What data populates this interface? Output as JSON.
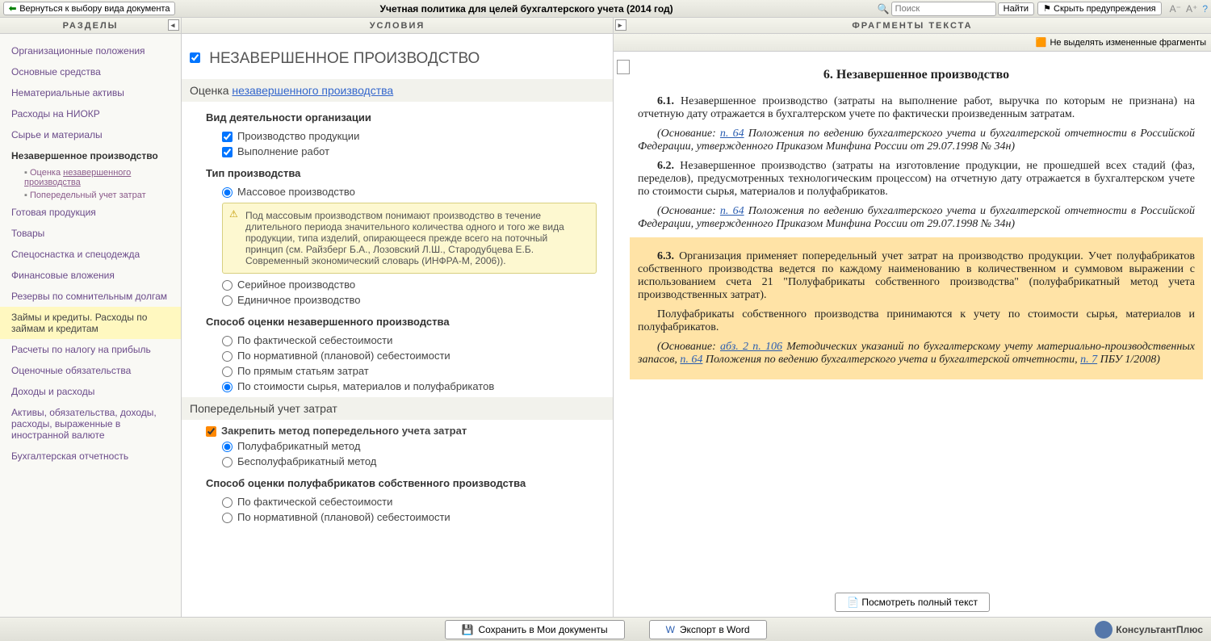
{
  "topbar": {
    "back": "Вернуться к выбору вида документа",
    "title": "Учетная политика для целей бухгалтерского учета (2014 год)",
    "search_placeholder": "Поиск",
    "find": "Найти",
    "hide_warn": "Скрыть предупреждения"
  },
  "headers": {
    "col1": "РАЗДЕЛЫ",
    "col2": "УСЛОВИЯ",
    "col3": "ФРАГМЕНТЫ ТЕКСТА"
  },
  "sidebar": {
    "items": [
      "Организационные положения",
      "Основные средства",
      "Нематериальные активы",
      "Расходы на НИОКР",
      "Сырье и материалы",
      "Незавершенное производство",
      "Готовая продукция",
      "Товары",
      "Спецоснастка и спецодежда",
      "Финансовые вложения",
      "Резервы по сомнительным долгам",
      "Займы и кредиты. Расходы по займам и кредитам",
      "Расчеты по налогу на прибыль",
      "Оценочные обязательства",
      "Доходы и расходы",
      "Активы, обязательства, доходы, расходы, выраженные в иностранной валюте",
      "Бухгалтерская отчетность"
    ],
    "sub": {
      "s1_prefix": "Оценка ",
      "s1_link": "незавершенного производства",
      "s2": "Попередельный учет затрат"
    }
  },
  "cond": {
    "main_title": "НЕЗАВЕРШЕННОЕ ПРОИЗВОДСТВО",
    "sec1_prefix": "Оценка ",
    "sec1_link": "незавершенного производства",
    "h_activity": "Вид деятельности организации",
    "c_prod": "Производство продукции",
    "c_work": "Выполнение работ",
    "h_type": "Тип производства",
    "r_mass": "Массовое производство",
    "info_mass": "Под массовым производством понимают производство в течение длительного периода значительного количества одного и того же вида продукции, типа изделий, опирающееся прежде всего на поточный принцип (см. Райзберг Б.А., Лозовский Л.Ш., Стародубцева Е.Б. Современный экономический словарь (ИНФРА-М, 2006)).",
    "r_serial": "Серийное производство",
    "r_single": "Единичное производство",
    "h_eval": "Способ оценки незавершенного производства",
    "r_fact": "По фактической себестоимости",
    "r_norm": "По нормативной (плановой) себестоимости",
    "r_direct": "По прямым статьям затрат",
    "r_cost": "По стоимости сырья, материалов и полуфабрикатов",
    "sec2": "Попередельный учет затрат",
    "c_fix": "Закрепить метод попередельного учета затрат",
    "r_semi": "Полуфабрикатный метод",
    "r_nonsemi": "Бесполуфабрикатный метод",
    "h_eval2": "Способ оценки полуфабрикатов собственного производства",
    "r_fact2": "По фактической себестоимости",
    "r_norm2": "По нормативной (плановой) себестоимости"
  },
  "frag": {
    "toolbar_btn": "Не выделять измененные фрагменты",
    "title": "6. Незавершенное производство",
    "p61_num": "6.1.",
    "p61": " Незавершенное производство (затраты на выполнение работ, выручка по которым не признана) на отчетную дату отражается в бухгалтерском учете по фактически произведенным затратам.",
    "base1_a": "(Основание: ",
    "link_p64": "п. 64",
    "base1_b": " Положения по ведению бухгалтерского учета и бухгалтерской отчетности в Российской Федерации, утвержденного Приказом Минфина России от 29.07.1998 № 34н)",
    "p62_num": "6.2.",
    "p62": " Незавершенное производство (затраты на изготовление продукции, не прошедшей всех стадий (фаз, переделов), предусмотренных технологическим процессом) на отчетную дату отражается в бухгалтерском учете по стоимости сырья, материалов и полуфабрикатов.",
    "p63_num": "6.3.",
    "p63": " Организация применяет попередельный учет затрат на производство продукции. Учет полуфабрикатов собственного производства ведется по каждому наименованию в количественном и суммовом выражении с использованием счета 21 \"Полуфабрикаты собственного производства\" (полуфабрикатный метод учета производственных затрат).",
    "p63b": "Полуфабрикаты собственного производства принимаются к учету по стоимости сырья, материалов и полуфабрикатов.",
    "base3_a": "(Основание: ",
    "link_abz": "абз. 2 п. 106",
    "base3_b": " Методических указаний по бухгалтерскому учету материально-производственных запасов, ",
    "base3_c": " Положения по ведению бухгалтерского учета и бухгалтерской отчетности, ",
    "link_p7": "п. 7",
    "base3_d": " ПБУ 1/2008)",
    "full_btn": "Посмотреть полный текст"
  },
  "bottom": {
    "save": "Сохранить в Мои документы",
    "export": "Экспорт в Word",
    "brand": "КонсультантПлюс"
  }
}
